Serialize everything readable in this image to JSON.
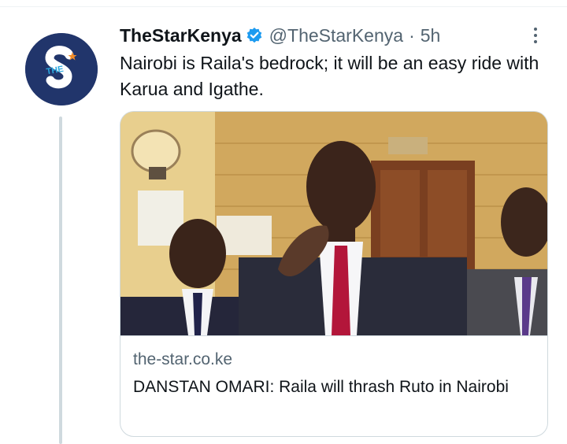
{
  "tweet": {
    "display_name": "TheStarKenya",
    "handle": "@TheStarKenya",
    "separator": "·",
    "time": "5h",
    "text": "Nairobi is Raila's bedrock; it will be an easy ride with Karua and Igathe.",
    "avatar_icon": "the-star-logo-icon",
    "verified_icon": "verified-badge-icon",
    "more_icon": "more-options-icon"
  },
  "card": {
    "domain": "the-star.co.ke",
    "title": "DANSTAN OMARI: Raila will thrash Ruto in Nairobi",
    "image_icon": "news-photo-image"
  },
  "colors": {
    "brand_navy": "#21356b",
    "brand_cyan": "#2aa9e0",
    "brand_orange": "#f28c28",
    "verified_blue": "#1d9bf0",
    "text_primary": "#0f1419",
    "text_secondary": "#536471",
    "border": "#cfd9de"
  }
}
